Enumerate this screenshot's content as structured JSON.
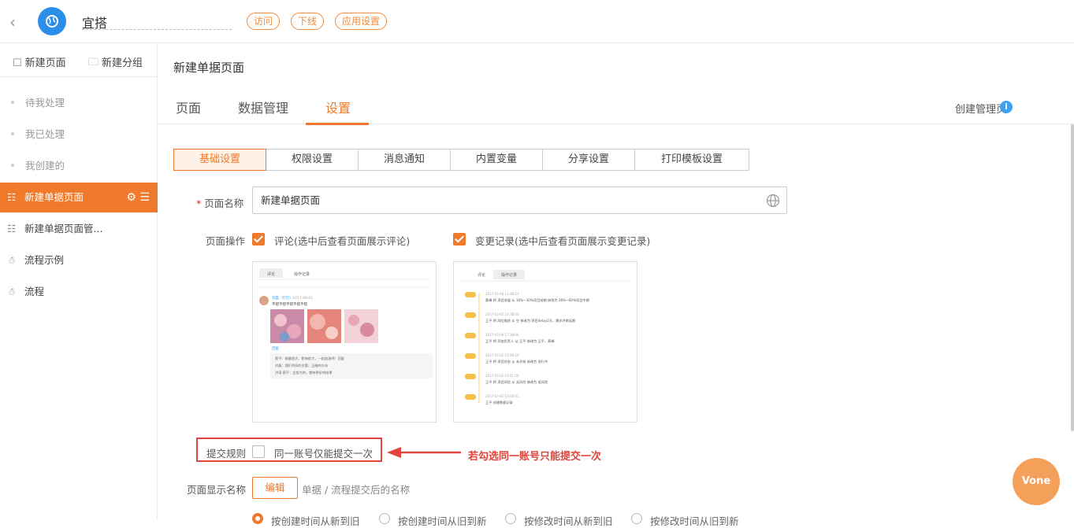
{
  "header": {
    "back_label": "<",
    "app_name": "宜搭",
    "actions": [
      "访问",
      "下线",
      "应用设置"
    ]
  },
  "sidebar": {
    "new_page_label": "新建页面",
    "new_group_label": "新建分组",
    "tasks": [
      "待我处理",
      "我已处理",
      "我创建的"
    ],
    "pages": [
      {
        "label": "新建单据页面",
        "icon": "form-page-icon",
        "active": true
      },
      {
        "label": "新建单据页面管...",
        "icon": "form-page-icon",
        "active": false
      },
      {
        "label": "流程示例",
        "icon": "flow-icon",
        "active": false
      },
      {
        "label": "流程",
        "icon": "flow-icon",
        "active": false
      }
    ]
  },
  "main": {
    "page_title": "新建单据页面",
    "tabs": [
      "页面",
      "数据管理",
      "设置"
    ],
    "active_tab": "设置",
    "create_manage_label": "创建管理页",
    "info_label": "i",
    "subtabs": [
      "基础设置",
      "权限设置",
      "消息通知",
      "内置变量",
      "分享设置",
      "打印模板设置"
    ],
    "active_subtab": "基础设置",
    "page_name_label": "页面名称",
    "page_name_value": "新建单据页面",
    "page_ops_label": "页面操作",
    "opt_comment": "评论(选中后查看页面展示评论)",
    "opt_changelog": "变更记录(选中后查看页面展示变更记录)",
    "submit_rule_label": "提交规则",
    "submit_rule_option": "同一账号仅能提交一次",
    "annotation": "若勾选同一账号只能提交一次",
    "display_name_label": "页面显示名称",
    "edit_button": "编辑",
    "display_name_hint": "单据 / 流程提交后的名称",
    "radio_options": [
      "按创建时间从新到旧",
      "按创建时间从旧到新",
      "按修改时间从新到旧",
      "按修改时间从旧到新"
    ]
  },
  "preview_comment": {
    "tabs": [
      "评论",
      "操作记录"
    ],
    "user": "刘磊（钉钉）",
    "time": "2017-08-01",
    "text": "不错不错不错不错不错",
    "reply": "回复",
    "replies": [
      "蔡平：能量很大，影响很大，一起加油吧！回复",
      "刘磊：我们共同的主题，正确的方向",
      "洪涛 蔡平：会努力的，期待更好的结果"
    ]
  },
  "preview_log": {
    "tabs": [
      "评论",
      "操作记录"
    ],
    "entries": [
      {
        "time": "2017-03-08 11:48:23",
        "text": "蔡峰 将 项目进展 从 10%~30%项目前期 修改为 30%~60%项目中期"
      },
      {
        "time": "2017-03-05 14:38:00",
        "text": "王平 将 风险描述 从 空 修改为 项目delay2天，需求评审延期"
      },
      {
        "time": "2017-03-08 17:38:00",
        "text": "王平 将 添加负责人 从 王平 修改为 王平，蔡峰"
      },
      {
        "time": "2017-03-02 15:48:24",
        "text": "王平 将 项目状态 从 未开始 修改为 进行中"
      },
      {
        "time": "2017-03-02 15:41:00",
        "text": "王平 将 项目风险 从 无风险 修改为 低风险"
      },
      {
        "time": "2017-03-02 15:00:01",
        "text": "王平 创建数据记录"
      }
    ]
  },
  "float_button": "Vone",
  "colors": {
    "accent": "#f07a2b",
    "annotation": "#e0443a",
    "logo": "#2b8ee8"
  }
}
